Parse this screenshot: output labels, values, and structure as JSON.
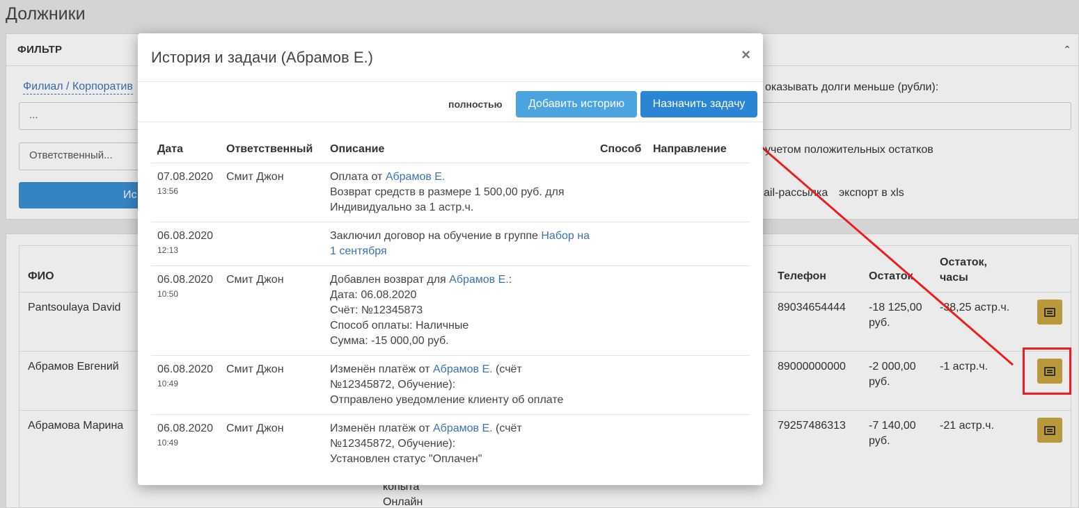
{
  "page": {
    "title": "Должники",
    "filter": {
      "heading": "ФИЛЬТР",
      "branch_link": "Филиал / Корпоратив",
      "branch_value": "...",
      "responsible_placeholder": "Ответственный...",
      "search_button": "Ис",
      "debt_less_label": "оказывать долги меньше (рубли):",
      "positive_balance_label": "учетом положительных остатков",
      "email_link": "ail-рассылка",
      "export_link": "экспорт в xls"
    },
    "table": {
      "headers": {
        "fio": "ФИО",
        "phone": "Телефон",
        "balance": "Остаток",
        "balance_hours": "Остаток, часы"
      },
      "rows": [
        {
          "fio": "Pantsoulaya David",
          "phone": "89034654444",
          "balance": "-18 125,00 руб.",
          "hours": "-38,25 астр.ч."
        },
        {
          "fio": "Абрамов Евгений",
          "phone": "89000000000",
          "balance": "-2 000,00 руб.",
          "hours": "-1 астр.ч."
        },
        {
          "fio": "Абрамова Марина",
          "phone": "79257486313",
          "balance": "-7 140,00 руб.",
          "hours": "-21 астр.ч."
        }
      ],
      "partial_text": [
        "копыта",
        "Онлайн"
      ]
    }
  },
  "modal": {
    "title": "История и задачи (Абрамов Е.)",
    "close": "×",
    "toolbar": {
      "full_label": "полностью",
      "add_history": "Добавить историю",
      "assign_task": "Назначить задачу"
    },
    "headers": {
      "date": "Дата",
      "responsible": "Ответственный",
      "description": "Описание",
      "method": "Способ",
      "direction": "Направление"
    },
    "rows": [
      {
        "date": "07.08.2020",
        "time": "13:56",
        "responsible": "Смит Джон",
        "desc_pre": "Оплата от ",
        "desc_link": "Абрамов Е.",
        "desc_post": "",
        "desc_lines": [
          "Возврат средств в размере 1 500,00 руб. для",
          "Индивидуально за 1 астр.ч."
        ]
      },
      {
        "date": "06.08.2020",
        "time": "12:13",
        "responsible": "",
        "desc_pre": "Заключил договор на обучение в группе ",
        "desc_link": "Набор на 1 сентября",
        "desc_post": "",
        "desc_lines": []
      },
      {
        "date": "06.08.2020",
        "time": "10:50",
        "responsible": "Смит Джон",
        "desc_pre": "Добавлен возврат для ",
        "desc_link": "Абрамов Е.",
        "desc_post": ":",
        "desc_lines": [
          "Дата: 06.08.2020",
          "Счёт: №12345873",
          "Способ оплаты: Наличные",
          "Сумма: -15 000,00 руб."
        ]
      },
      {
        "date": "06.08.2020",
        "time": "10:49",
        "responsible": "Смит Джон",
        "desc_pre": "Изменён платёж от ",
        "desc_link": "Абрамов Е.",
        "desc_post": " (счёт",
        "desc_lines": [
          "№12345872, Обучение):",
          "Отправлено уведомление клиенту об оплате"
        ]
      },
      {
        "date": "06.08.2020",
        "time": "10:49",
        "responsible": "Смит Джон",
        "desc_pre": "Изменён платёж от ",
        "desc_link": "Абрамов Е.",
        "desc_post": " (счёт",
        "desc_lines": [
          "№12345872, Обучение):",
          "Установлен статус \"Оплачен\""
        ]
      }
    ]
  },
  "colors": {
    "link": "#3c72b8",
    "primary": "#2a86d4",
    "accent_annotation": "#ee1c1c",
    "doc_button": "#c9a642"
  }
}
